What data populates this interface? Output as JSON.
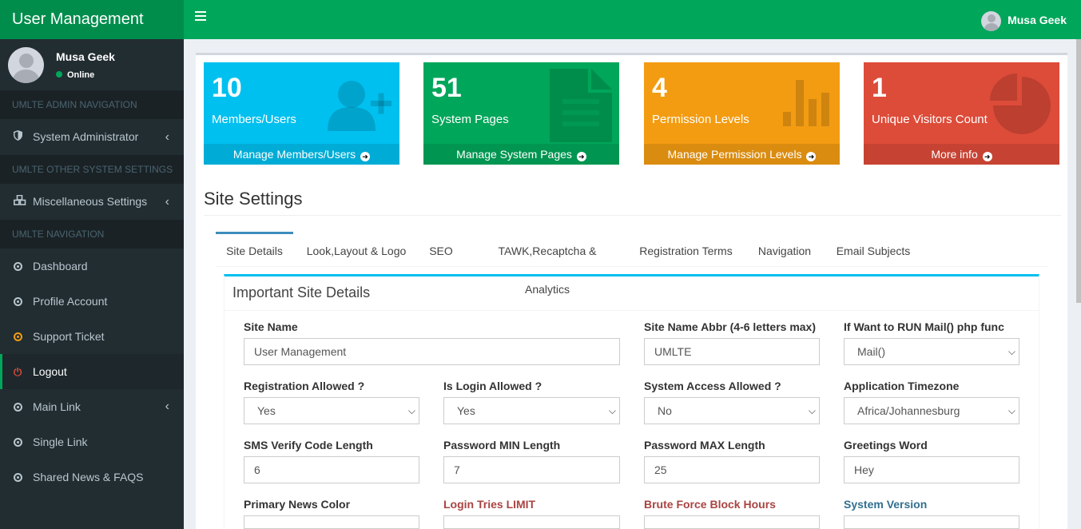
{
  "app": {
    "title": "User Management"
  },
  "sidebar": {
    "user_name": "Musa Geek",
    "user_status": "Online",
    "headers": [
      "UMLTE ADMIN NAVIGATION",
      "UMLTE OTHER SYSTEM SETTINGS",
      "UMLTE NAVIGATION"
    ],
    "items": [
      {
        "label": "System Administrator",
        "icon": "shield-icon"
      },
      {
        "label": "Miscellaneous Settings",
        "icon": "cubes-icon"
      },
      {
        "label": "Dashboard",
        "icon": "circle-o-icon"
      },
      {
        "label": "Profile Account",
        "icon": "circle-o-icon"
      },
      {
        "label": "Support Ticket",
        "icon": "circle-o-icon"
      },
      {
        "label": "Logout",
        "icon": "power-icon"
      },
      {
        "label": "Main Link",
        "icon": "circle-o-icon"
      },
      {
        "label": "Single Link",
        "icon": "circle-o-icon"
      },
      {
        "label": "Shared News & FAQS",
        "icon": "circle-o-icon"
      }
    ]
  },
  "topbar": {
    "user_name": "Musa Geek"
  },
  "stats": [
    {
      "value": "10",
      "label": "Members/Users",
      "link": "Manage Members/Users",
      "color": "#00c0ef",
      "icon": "user-plus-icon"
    },
    {
      "value": "51",
      "label": "System Pages",
      "link": "Manage System Pages",
      "color": "#00a65a",
      "icon": "file-text-icon"
    },
    {
      "value": "4",
      "label": "Permission Levels",
      "link": "Manage Permission Levels",
      "color": "#f39c12",
      "icon": "bar-chart-icon"
    },
    {
      "value": "1",
      "label": "Unique Visitors Count",
      "link": "More info",
      "color": "#dd4b39",
      "icon": "pie-chart-icon"
    }
  ],
  "main": {
    "section_title": "Site Settings",
    "tabs": [
      "Site Details",
      "Look,Layout & Logo",
      "SEO",
      "TAWK,Recaptcha & Analytics",
      "Registration Terms",
      "Navigation",
      "Email Subjects"
    ],
    "panel_title": "Important Site Details"
  },
  "form": {
    "site_name": {
      "label": "Site Name",
      "value": "User Management"
    },
    "site_abbr": {
      "label": "Site Name Abbr (4-6 letters max)",
      "value": "UMLTE"
    },
    "mail_func": {
      "label": "If Want to RUN Mail() php func",
      "value": "Mail()"
    },
    "registration": {
      "label": "Registration Allowed ?",
      "value": "Yes"
    },
    "login": {
      "label": "Is Login Allowed ?",
      "value": "Yes"
    },
    "system_access": {
      "label": "System Access Allowed ?",
      "value": "No"
    },
    "timezone": {
      "label": "Application Timezone",
      "value": "Africa/Johannesburg"
    },
    "sms_length": {
      "label": "SMS Verify Code Length",
      "value": "6"
    },
    "pw_min": {
      "label": "Password MIN Length",
      "value": "7"
    },
    "pw_max": {
      "label": "Password MAX Length",
      "value": "25"
    },
    "greeting": {
      "label": "Greetings Word",
      "value": "Hey"
    },
    "news_color": {
      "label": "Primary News Color"
    },
    "login_tries": {
      "label": "Login Tries LIMIT"
    },
    "brute_force": {
      "label": "Brute Force Block Hours"
    },
    "sys_version": {
      "label": "System Version"
    }
  }
}
